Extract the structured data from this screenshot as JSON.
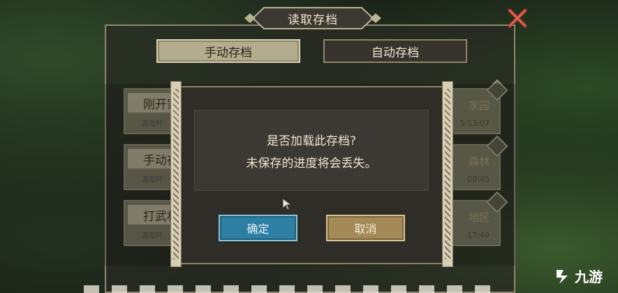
{
  "window": {
    "title": "读取存档"
  },
  "tabs": [
    {
      "label": "手动存档",
      "active": true
    },
    {
      "label": "自动存档",
      "active": false
    }
  ],
  "slots": [
    {
      "name": "刚开家园",
      "sub": "游戏时",
      "area": "家园",
      "time": "5.13:07"
    },
    {
      "name": "手动存档 5",
      "sub": "游戏时",
      "area": "森林",
      "time": "00:45"
    },
    {
      "name": "打武林盟主线",
      "sub": "游戏时",
      "area": "地区",
      "time": "17:49"
    }
  ],
  "dialog": {
    "line1": "是否加载此存档?",
    "line2": "未保存的进度将会丢失。",
    "confirm_label": "确定",
    "cancel_label": "取消"
  },
  "watermark": {
    "text": "九游"
  },
  "colors": {
    "confirm": "#2d7fa4",
    "cancel": "#a48a56",
    "panel_border": "#8f876f"
  }
}
